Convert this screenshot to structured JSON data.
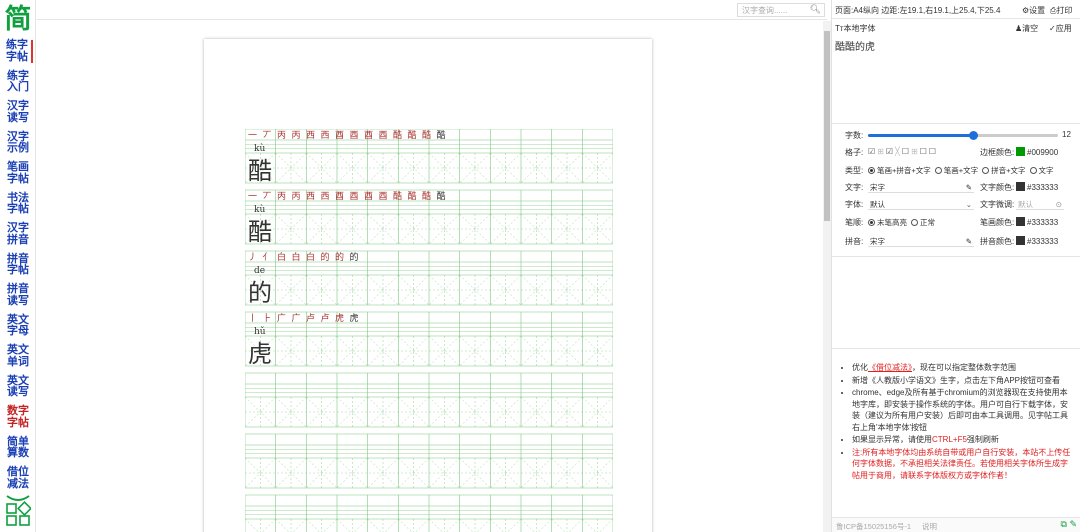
{
  "sidebar": {
    "logo": "简",
    "items": [
      "练字\n字帖",
      "练字\n入门",
      "汉字\n读写",
      "汉字\n示例",
      "笔画\n字帖",
      "书法\n字帖",
      "汉字\n拼音",
      "拼音\n字帖",
      "拼音\n读写",
      "英文\n字母",
      "英文\n单词",
      "英文\n读写",
      "数字\n字帖",
      "简单\n算数",
      "借位\n减法"
    ]
  },
  "topbar": {
    "search_placeholder": "汉字查询......",
    "page_info": "页面:A4纵向 边距:左19.1,右19.1,上25.4,下25.4",
    "settings": "设置",
    "print": "打印"
  },
  "panel": {
    "font_toggle": "Tт本地字体",
    "clear": "清空",
    "apply": "应用",
    "text_content": "酷酷的虎",
    "count_label": "字数:",
    "count_value": "12",
    "count_fraction": 0.55,
    "grid_label": "格子:",
    "border_color_label": "边框颜色:",
    "border_color": "#009900",
    "type_label": "类型:",
    "type_options": [
      "笔画+拼音+文字",
      "笔画+文字",
      "拼音+文字",
      "文字"
    ],
    "text_label": "文字:",
    "text_font": "宋字",
    "text_color_label": "文字颜色:",
    "text_color": "#333333",
    "font_label": "字体:",
    "font_value": "默认",
    "text_tune_label": "文字微调:",
    "text_tune_placeholder": "默认",
    "stroke_label": "笔顺:",
    "stroke_options": [
      "末笔高亮",
      "正常"
    ],
    "stroke_color_label": "笔画颜色:",
    "stroke_color": "#333333",
    "pinyin_label": "拼音:",
    "pinyin_font": "宋字",
    "pinyin_color_label": "拼音颜色:",
    "pinyin_color": "#333333"
  },
  "notes": [
    {
      "pre": "优化",
      "link": "《借位减法》",
      "post": "，现在可以指定整体数字范围"
    },
    {
      "pre": "新增《人教版小学语文》生字，点击左下角APP按钮可查看",
      "link": "",
      "post": ""
    },
    {
      "pre": "chrome、edge及所有基于chromium的浏览器现在支持使用本地字库，即安装于操作系统的字体。用户可自行下载字体，安装（建议为所有用户安装）后即可由本工具调用。见字帖工具右上角'本地字体'按钮",
      "link": "",
      "post": ""
    },
    {
      "pre": "如果显示异常，请使用",
      "link": "CTRL+F5",
      "post": "强制刷新"
    },
    {
      "pre": "",
      "link": "注:所有本地字体均由系统自带或用户自行安装，本站不上传任何字体数据，不承担相关法律责任。若使用相关字体所生成字帖用于商用，请联系字体版权方或字体作者！",
      "post": ""
    }
  ],
  "statusbar": {
    "icp": "鲁ICP备15025156号-1",
    "hint": "说明"
  },
  "worksheet": [
    {
      "strokes": [
        "一",
        "丆",
        "丙",
        "丙",
        "西",
        "西",
        "酉",
        "酉",
        "酉",
        "酉",
        "酷",
        "酷",
        "酷",
        "酷"
      ],
      "pinyin": "kù",
      "char": "酷"
    },
    {
      "strokes": [
        "一",
        "丆",
        "丙",
        "丙",
        "西",
        "西",
        "酉",
        "酉",
        "酉",
        "酉",
        "酷",
        "酷",
        "酷",
        "酷"
      ],
      "pinyin": "kù",
      "char": "酷"
    },
    {
      "strokes": [
        "丿",
        "亻",
        "白",
        "白",
        "白",
        "的",
        "的",
        "的"
      ],
      "pinyin": "de",
      "char": "的"
    },
    {
      "strokes": [
        "丨",
        "⺊",
        "广",
        "广",
        "卢",
        "卢",
        "虎",
        "虎"
      ],
      "pinyin": "hǔ",
      "char": "虎"
    }
  ],
  "colors": {
    "grid": "#7ec87e",
    "nav": "#1a3fb5",
    "accent_red": "#d33",
    "logo": "#10a040"
  }
}
